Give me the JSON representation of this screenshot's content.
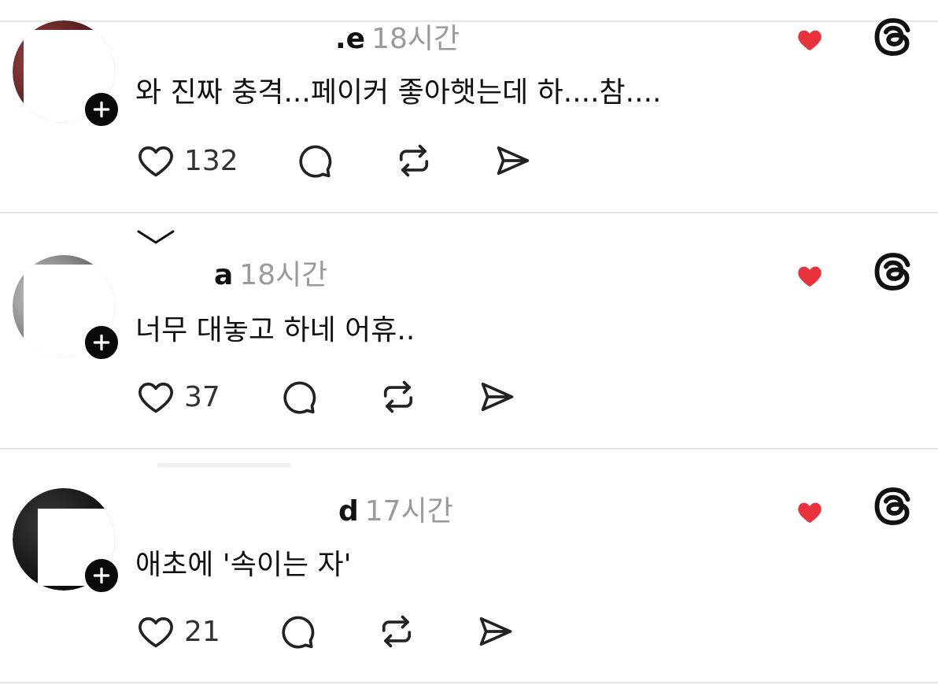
{
  "posts": [
    {
      "username": ".e",
      "time": "18시간",
      "text": "와 진짜 충격...페이커 좋아햇는데 하....참....",
      "like_count": "132",
      "avatar_color": "#6b2a2a"
    },
    {
      "username": "a",
      "time": "18시간",
      "text": "너무 대놓고 하네 어휴..",
      "like_count": "37",
      "avatar_color": "#777777"
    },
    {
      "username": "d",
      "time": "17시간",
      "text": "애초에 '속이는 자'",
      "like_count": "21",
      "avatar_color": "#141414"
    }
  ],
  "icons": {
    "like": "heart-outline-icon",
    "comment": "comment-bubble-icon",
    "repost": "repost-icon",
    "share": "send-icon",
    "liked_by_author": "red-heart-icon",
    "threads": "threads-logo-icon",
    "follow": "plus-icon",
    "collapse": "chevron-down-icon"
  },
  "colors": {
    "text": "#111111",
    "muted": "#9a9a9a",
    "heart": "#e8323c",
    "divider": "#e6e6e6",
    "badge": "#0a0a0a"
  }
}
